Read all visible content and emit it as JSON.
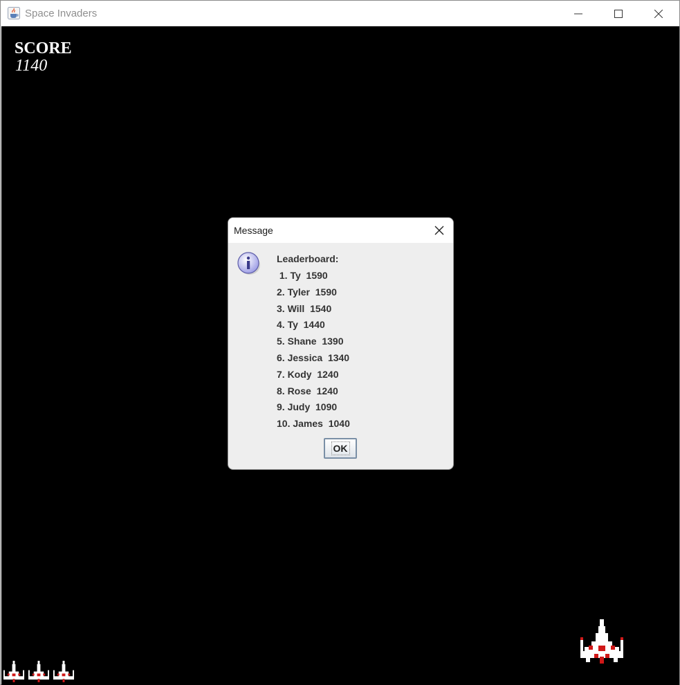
{
  "window": {
    "title": "Space Invaders",
    "icon": "java-cup-icon"
  },
  "hud": {
    "score_label": "SCORE",
    "score_value": "1140",
    "lives_remaining": 3
  },
  "dialog": {
    "title": "Message",
    "icon": "information-icon",
    "heading": "Leaderboard:",
    "entries": [
      " 1. Ty  1590",
      "2. Tyler  1590",
      "3. Will  1540",
      "4. Ty  1440",
      "5. Shane  1390",
      "6. Jessica  1340",
      "7. Kody  1240",
      "8. Rose  1240",
      "9. Judy  1090",
      "10. James  1040"
    ],
    "ok_label": "OK"
  },
  "colors": {
    "game_background": "#000000",
    "dialog_background": "#eeeeee",
    "ship_white": "#ffffff",
    "ship_red": "#d01818"
  }
}
